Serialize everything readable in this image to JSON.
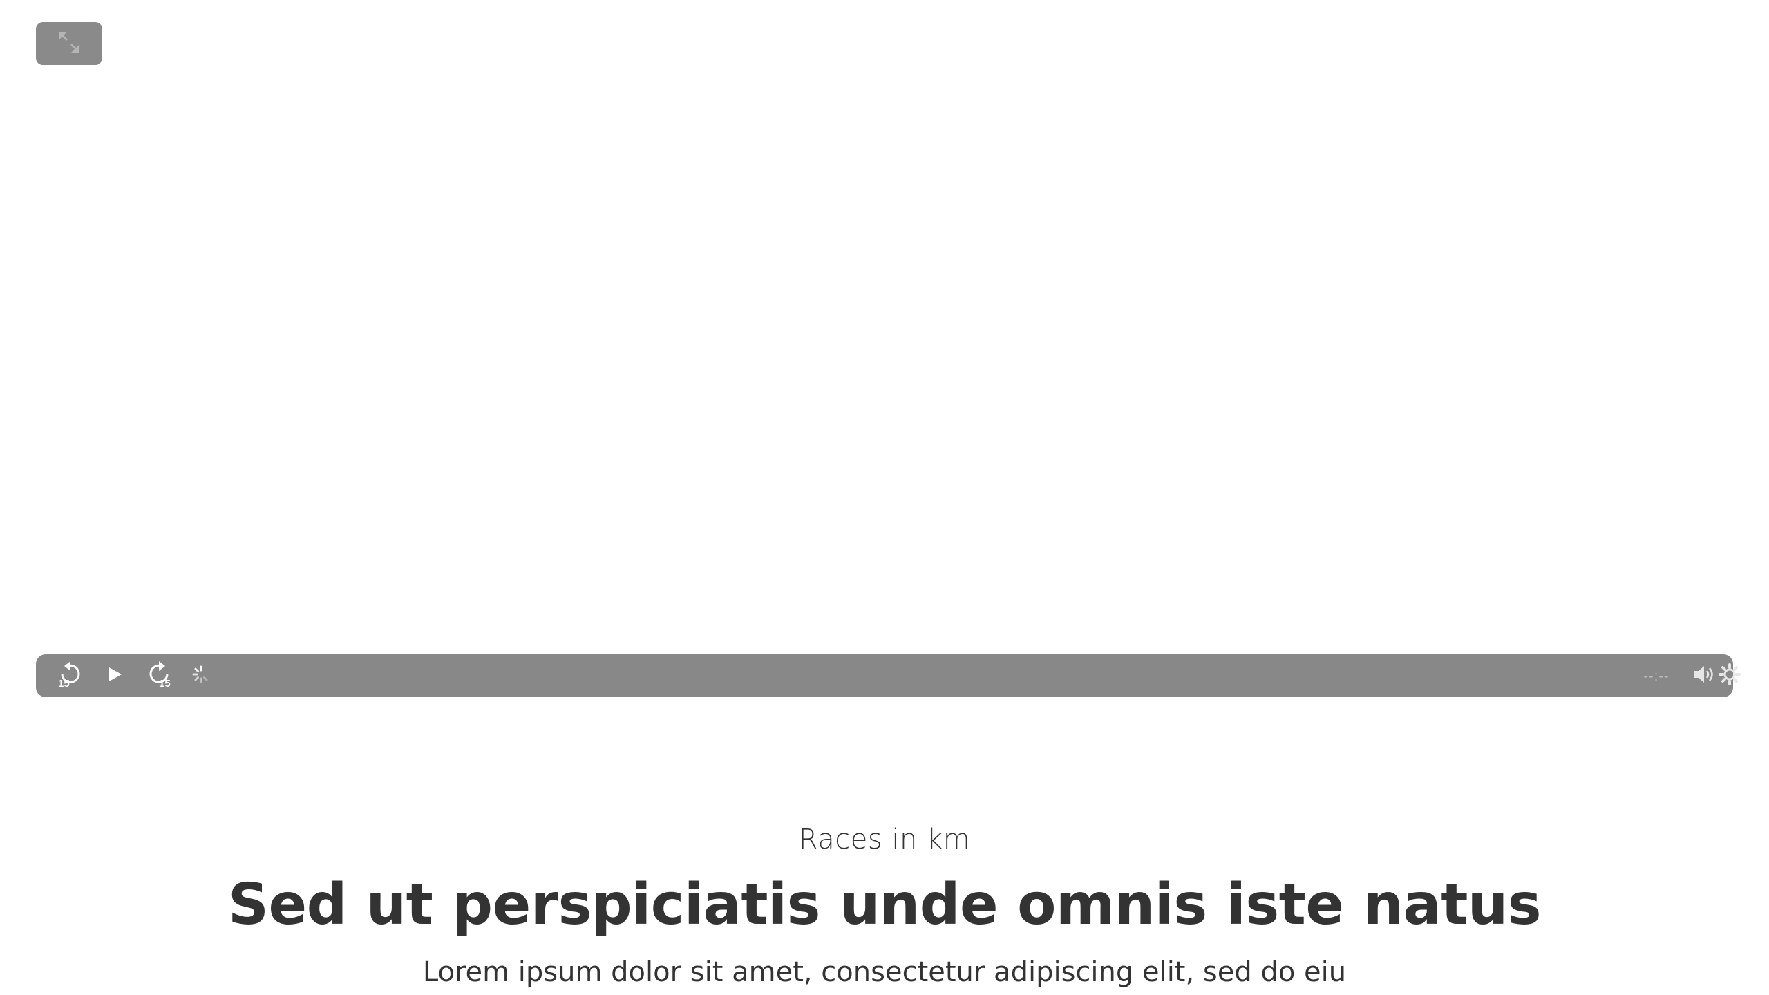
{
  "player": {
    "skip_back_seconds": "15",
    "skip_forward_seconds": "15",
    "time_display": "--:--",
    "icons": {
      "fullscreen": "fullscreen-icon",
      "rewind": "rewind-15-icon",
      "play": "play-icon",
      "forward": "forward-15-icon",
      "loading": "loading-spinner-icon",
      "volume": "volume-icon",
      "settings": "gear-icon"
    },
    "colors": {
      "controls_bg": "#888888",
      "icon": "#ffffff"
    }
  },
  "content": {
    "eyebrow": "Races in km",
    "headline": "Sed ut perspiciatis unde omnis iste natus",
    "subtext": "Lorem ipsum dolor sit amet, consectetur adipiscing elit, sed do eiu"
  }
}
